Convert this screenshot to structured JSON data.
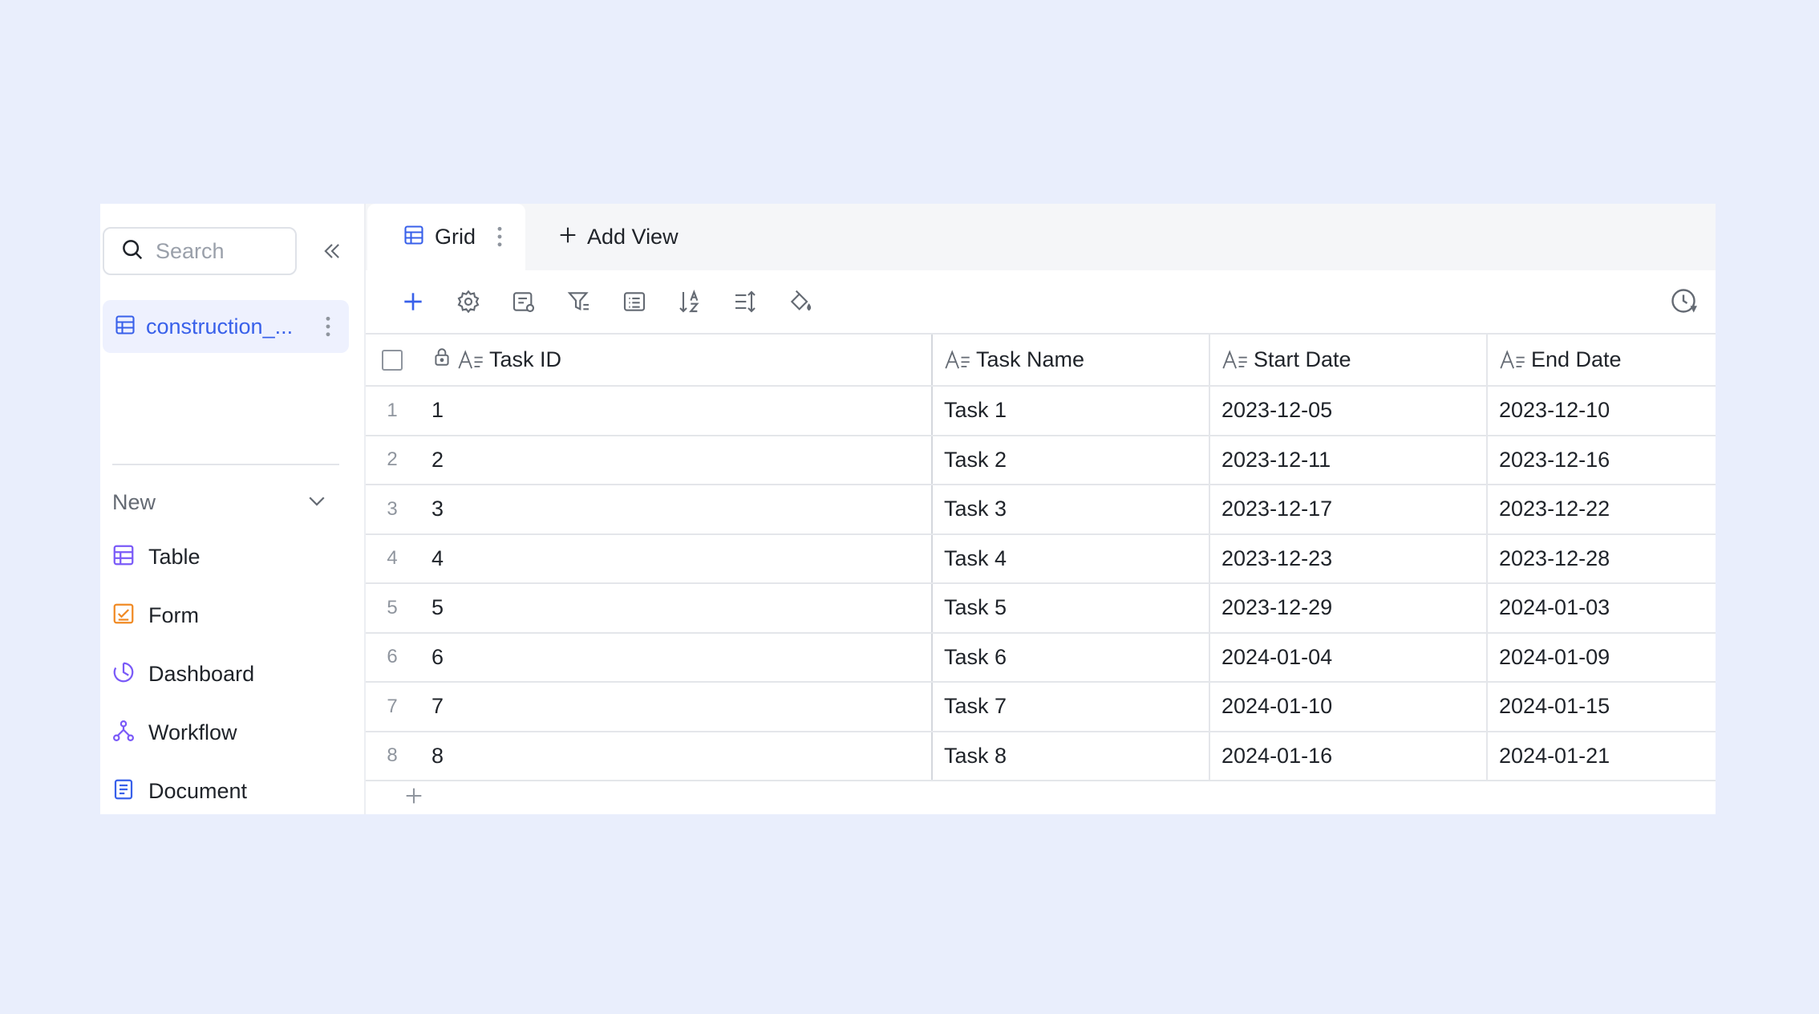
{
  "sidebar": {
    "search_placeholder": "Search",
    "base_name": "construction_...",
    "new_label": "New",
    "new_items": [
      {
        "label": "Table",
        "icon": "table-icon",
        "color": "#7a5af8"
      },
      {
        "label": "Form",
        "icon": "form-icon",
        "color": "#f08a24"
      },
      {
        "label": "Dashboard",
        "icon": "dashboard-icon",
        "color": "#7a5af8"
      },
      {
        "label": "Workflow",
        "icon": "workflow-icon",
        "color": "#7a5af8"
      },
      {
        "label": "Document",
        "icon": "document-icon",
        "color": "#3860ea"
      }
    ]
  },
  "tabs": {
    "active_label": "Grid",
    "add_view_label": "Add View"
  },
  "toolbar": {
    "icons": [
      "add-icon",
      "settings-icon",
      "field-settings-icon",
      "filter-icon",
      "group-icon",
      "sort-icon",
      "row-height-icon",
      "color-fill-icon"
    ],
    "history_icon": "history-icon"
  },
  "grid": {
    "columns": [
      "Task ID",
      "Task Name",
      "Start Date",
      "End Date"
    ],
    "rows": [
      {
        "idx": "1",
        "id": "1",
        "name": "Task 1",
        "start": "2023-12-05",
        "end": "2023-12-10"
      },
      {
        "idx": "2",
        "id": "2",
        "name": "Task 2",
        "start": "2023-12-11",
        "end": "2023-12-16"
      },
      {
        "idx": "3",
        "id": "3",
        "name": "Task 3",
        "start": "2023-12-17",
        "end": "2023-12-22"
      },
      {
        "idx": "4",
        "id": "4",
        "name": "Task 4",
        "start": "2023-12-23",
        "end": "2023-12-28"
      },
      {
        "idx": "5",
        "id": "5",
        "name": "Task 5",
        "start": "2023-12-29",
        "end": "2024-01-03"
      },
      {
        "idx": "6",
        "id": "6",
        "name": "Task 6",
        "start": "2024-01-04",
        "end": "2024-01-09"
      },
      {
        "idx": "7",
        "id": "7",
        "name": "Task 7",
        "start": "2024-01-10",
        "end": "2024-01-15"
      },
      {
        "idx": "8",
        "id": "8",
        "name": "Task 8",
        "start": "2024-01-16",
        "end": "2024-01-21"
      }
    ]
  },
  "colors": {
    "accent": "#3860ea",
    "background": "#e9eefc"
  }
}
